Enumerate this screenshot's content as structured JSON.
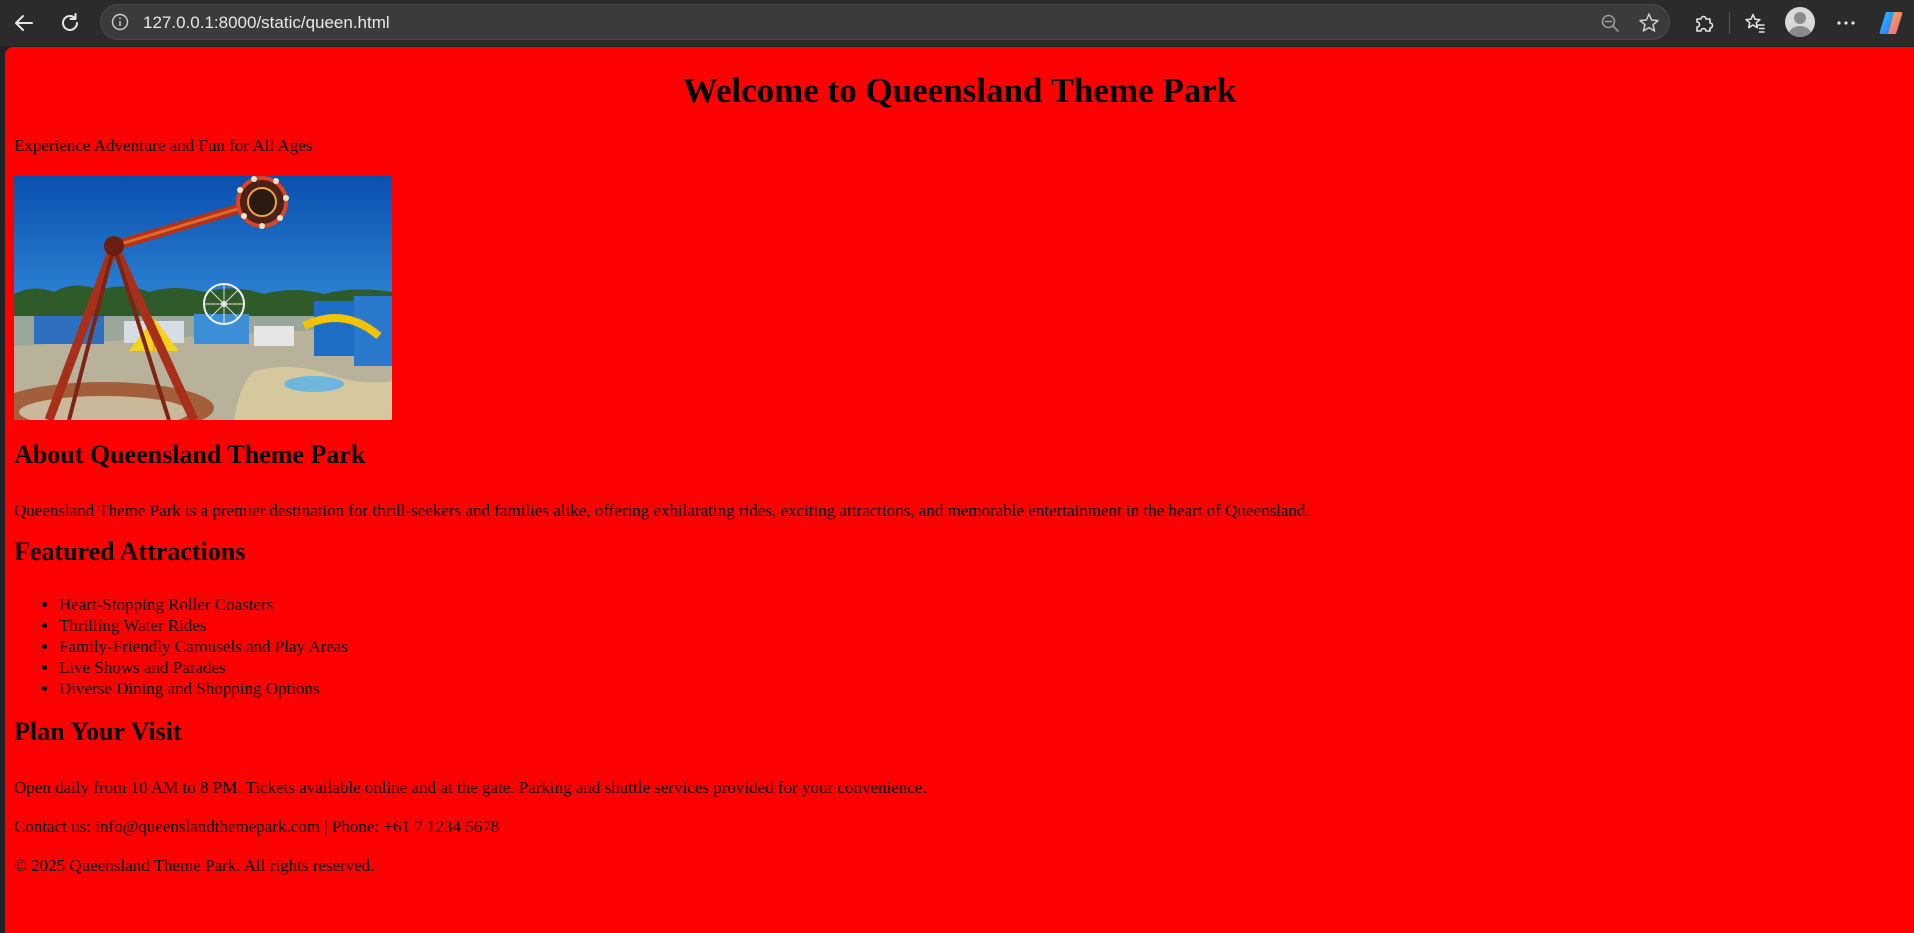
{
  "browser": {
    "url": "127.0.0.1:8000/static/queen.html"
  },
  "page": {
    "background_color": "#ff0000",
    "title": "Welcome to Queensland Theme Park",
    "tagline": "Experience Adventure and Fun for All Ages",
    "hero_image_alt": "theme park photo",
    "about": {
      "heading": "About Queensland Theme Park",
      "text": "Queensland Theme Park is a premier destination for thrill-seekers and families alike, offering exhilarating rides, exciting attractions, and memorable entertainment in the heart of Queensland."
    },
    "attractions": {
      "heading": "Featured Attractions",
      "items": [
        "Heart-Stopping Roller Coasters",
        "Thrilling Water Rides",
        "Family-Friendly Carousels and Play Areas",
        "Live Shows and Parades",
        "Diverse Dining and Shopping Options"
      ]
    },
    "visit": {
      "heading": "Plan Your Visit",
      "text": "Open daily from 10 AM to 8 PM. Tickets available online and at the gate. Parking and shuttle services provided for your convenience."
    },
    "contact": "Contact us: info@queenslandthemepark.com | Phone: +61 7 1234 5678",
    "copyright": "© 2025 Queensland Theme Park. All rights reserved."
  }
}
